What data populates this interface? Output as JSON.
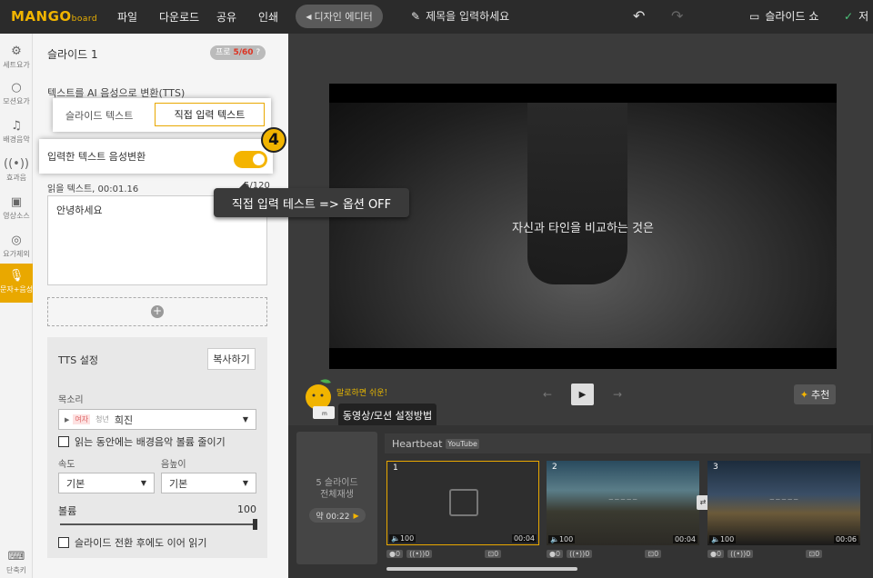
{
  "topbar": {
    "logo_main": "MANGO",
    "logo_sub": "board",
    "menu": [
      "파일",
      "다운로드",
      "공유",
      "인쇄"
    ],
    "design_editor": "디자인 에디터",
    "title_placeholder": "제목을 입력하세요",
    "slideshow": "슬라이드 쇼",
    "save": "저"
  },
  "iconbar": {
    "items": [
      "세트요가",
      "모션요가",
      "배경음악",
      "효과음",
      "영상소스",
      "요가제외",
      "문자+음성",
      "단축키"
    ]
  },
  "panel": {
    "title": "슬라이드 1",
    "pro_prefix": "프로",
    "pro_count": "5/60",
    "tts_heading": "텍스트를 AI 음성으로 변환(TTS)",
    "tab_slide_text": "슬라이드 텍스트",
    "tab_direct_text": "직접 입력 텍스트",
    "toggle_label": "입력한 텍스트 음성변환",
    "step_number": "4",
    "read_text_label": "읽을 텍스트, 00:01.16",
    "read_text_count": "5/120",
    "text_value": "안녕하세요",
    "tts_settings": "TTS 설정",
    "copy_button": "복사하기",
    "voice_label": "목소리",
    "voice_tag_female": "여자",
    "voice_tag_age": "청년",
    "voice_name": "희진",
    "bgm_checkbox": "읽는 동안에는 배경음악 볼륨 줄이기",
    "speed_label": "속도",
    "pitch_label": "음높이",
    "speed_value": "기본",
    "pitch_value": "기본",
    "volume_label": "볼륨",
    "volume_value": "100",
    "continue_checkbox": "슬라이드 전환 후에도 이어 읽기"
  },
  "stage": {
    "subtitle": "자신과 타인을 비교하는 것은",
    "tooltip": "직접 입력 테스트 => 옵션 OFF",
    "recommend": "추천",
    "mascot_text": "말로하면 쉬운!",
    "guide_button": "동영상/모션 설정방법"
  },
  "timeline": {
    "all_play_line1": "5 슬라이드",
    "all_play_line2": "전체재생",
    "all_time": "약 00:22",
    "audio_name": "Heartbeat",
    "youtube_tag": "YouTube",
    "slides": [
      {
        "num": "1",
        "vol": "100",
        "dur": "00:04",
        "fx": "0",
        "tts": "0",
        "trans": "0"
      },
      {
        "num": "2",
        "vol": "100",
        "dur": "00:04",
        "fx": "0",
        "tts": "0",
        "trans": "0"
      },
      {
        "num": "3",
        "vol": "100",
        "dur": "00:06",
        "fx": "0",
        "tts": "0",
        "trans": "0"
      }
    ]
  },
  "colors": {
    "accent": "#f4b400",
    "dark": "#2b2b2b"
  }
}
